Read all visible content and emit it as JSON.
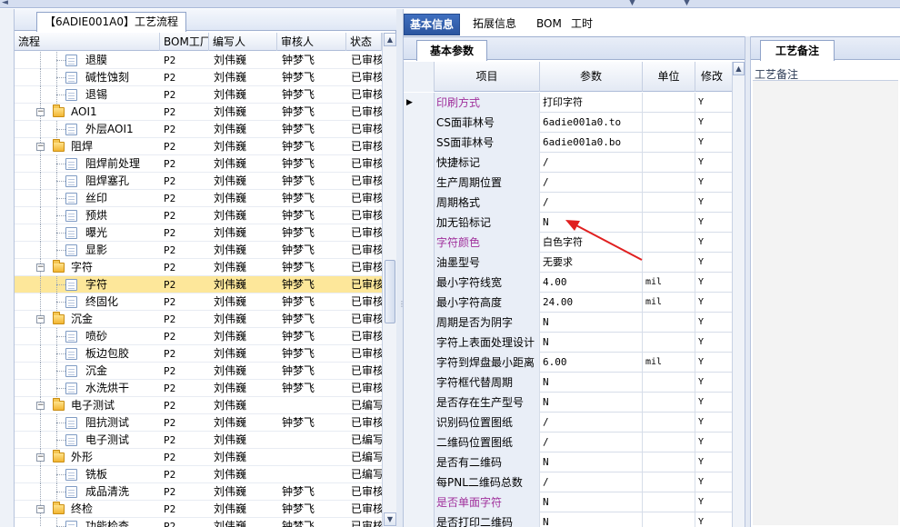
{
  "left_panel": {
    "tab_title": "【6ADIE001A0】工艺流程",
    "columns": [
      "流程",
      "BOM工厂",
      "编写人",
      "审核人",
      "状态"
    ],
    "rows": [
      {
        "name": "退膜",
        "bom": "P2",
        "writer": "刘伟巍",
        "reviewer": "钟梦飞",
        "status": "已审核",
        "level": 2
      },
      {
        "name": "碱性蚀刻",
        "bom": "P2",
        "writer": "刘伟巍",
        "reviewer": "钟梦飞",
        "status": "已审核",
        "level": 2
      },
      {
        "name": "退锡",
        "bom": "P2",
        "writer": "刘伟巍",
        "reviewer": "钟梦飞",
        "status": "已审核",
        "level": 2
      },
      {
        "name": "AOI1",
        "bom": "P2",
        "writer": "刘伟巍",
        "reviewer": "钟梦飞",
        "status": "已审核",
        "level": 1
      },
      {
        "name": "外层AOI1",
        "bom": "P2",
        "writer": "刘伟巍",
        "reviewer": "钟梦飞",
        "status": "已审核",
        "level": 2
      },
      {
        "name": "阻焊",
        "bom": "P2",
        "writer": "刘伟巍",
        "reviewer": "钟梦飞",
        "status": "已审核",
        "level": 1
      },
      {
        "name": "阻焊前处理",
        "bom": "P2",
        "writer": "刘伟巍",
        "reviewer": "钟梦飞",
        "status": "已审核",
        "level": 2
      },
      {
        "name": "阻焊塞孔",
        "bom": "P2",
        "writer": "刘伟巍",
        "reviewer": "钟梦飞",
        "status": "已审核",
        "level": 2
      },
      {
        "name": "丝印",
        "bom": "P2",
        "writer": "刘伟巍",
        "reviewer": "钟梦飞",
        "status": "已审核",
        "level": 2
      },
      {
        "name": "预烘",
        "bom": "P2",
        "writer": "刘伟巍",
        "reviewer": "钟梦飞",
        "status": "已审核",
        "level": 2
      },
      {
        "name": "曝光",
        "bom": "P2",
        "writer": "刘伟巍",
        "reviewer": "钟梦飞",
        "status": "已审核",
        "level": 2
      },
      {
        "name": "显影",
        "bom": "P2",
        "writer": "刘伟巍",
        "reviewer": "钟梦飞",
        "status": "已审核",
        "level": 2
      },
      {
        "name": "字符",
        "bom": "P2",
        "writer": "刘伟巍",
        "reviewer": "钟梦飞",
        "status": "已审核",
        "level": 1
      },
      {
        "name": "字符",
        "bom": "P2",
        "writer": "刘伟巍",
        "reviewer": "钟梦飞",
        "status": "已审核",
        "level": 2,
        "selected": true
      },
      {
        "name": "终固化",
        "bom": "P2",
        "writer": "刘伟巍",
        "reviewer": "钟梦飞",
        "status": "已审核",
        "level": 2
      },
      {
        "name": "沉金",
        "bom": "P2",
        "writer": "刘伟巍",
        "reviewer": "钟梦飞",
        "status": "已审核",
        "level": 1
      },
      {
        "name": "喷砂",
        "bom": "P2",
        "writer": "刘伟巍",
        "reviewer": "钟梦飞",
        "status": "已审核",
        "level": 2
      },
      {
        "name": "板边包胶",
        "bom": "P2",
        "writer": "刘伟巍",
        "reviewer": "钟梦飞",
        "status": "已审核",
        "level": 2
      },
      {
        "name": "沉金",
        "bom": "P2",
        "writer": "刘伟巍",
        "reviewer": "钟梦飞",
        "status": "已审核",
        "level": 2
      },
      {
        "name": "水洗烘干",
        "bom": "P2",
        "writer": "刘伟巍",
        "reviewer": "钟梦飞",
        "status": "已审核",
        "level": 2
      },
      {
        "name": "电子测试",
        "bom": "P2",
        "writer": "刘伟巍",
        "reviewer": "",
        "status": "已编写",
        "level": 1
      },
      {
        "name": "阻抗测试",
        "bom": "P2",
        "writer": "刘伟巍",
        "reviewer": "钟梦飞",
        "status": "已审核",
        "level": 2
      },
      {
        "name": "电子测试",
        "bom": "P2",
        "writer": "刘伟巍",
        "reviewer": "",
        "status": "已编写",
        "level": 2
      },
      {
        "name": "外形",
        "bom": "P2",
        "writer": "刘伟巍",
        "reviewer": "",
        "status": "已编写",
        "level": 1
      },
      {
        "name": "铣板",
        "bom": "P2",
        "writer": "刘伟巍",
        "reviewer": "",
        "status": "已编写",
        "level": 2
      },
      {
        "name": "成品清洗",
        "bom": "P2",
        "writer": "刘伟巍",
        "reviewer": "钟梦飞",
        "status": "已审核",
        "level": 2
      },
      {
        "name": "终检",
        "bom": "P2",
        "writer": "刘伟巍",
        "reviewer": "钟梦飞",
        "status": "已审核",
        "level": 1
      },
      {
        "name": "功能检查",
        "bom": "P2",
        "writer": "刘伟巍",
        "reviewer": "钟梦飞",
        "status": "已审核",
        "level": 2
      }
    ]
  },
  "middle_panel": {
    "tabs": [
      "基本信息",
      "拓展信息",
      "BOM",
      "工时"
    ],
    "active_tab": "基本信息",
    "sub_tab": "基本参数",
    "columns": [
      "项目",
      "参数",
      "单位",
      "修改"
    ],
    "rows": [
      {
        "item": "印刷方式",
        "value": "打印字符",
        "unit": "",
        "mod": "Y",
        "highlight": true,
        "current": true
      },
      {
        "item": "CS面菲林号",
        "value": "6adie001a0.to",
        "unit": "",
        "mod": "Y"
      },
      {
        "item": "SS面菲林号",
        "value": "6adie001a0.bo",
        "unit": "",
        "mod": "Y"
      },
      {
        "item": "快捷标记",
        "value": "/",
        "unit": "",
        "mod": "Y"
      },
      {
        "item": "生产周期位置",
        "value": "/",
        "unit": "",
        "mod": "Y"
      },
      {
        "item": "周期格式",
        "value": "/",
        "unit": "",
        "mod": "Y"
      },
      {
        "item": "加无铅标记",
        "value": "N",
        "unit": "",
        "mod": "Y"
      },
      {
        "item": "字符颜色",
        "value": "白色字符",
        "unit": "",
        "mod": "Y",
        "highlight": true
      },
      {
        "item": "油墨型号",
        "value": "无要求",
        "unit": "",
        "mod": "Y"
      },
      {
        "item": "最小字符线宽",
        "value": "4.00",
        "unit": "mil",
        "mod": "Y"
      },
      {
        "item": "最小字符高度",
        "value": "24.00",
        "unit": "mil",
        "mod": "Y"
      },
      {
        "item": "周期是否为阴字",
        "value": "N",
        "unit": "",
        "mod": "Y"
      },
      {
        "item": "字符上表面处理设计",
        "value": "N",
        "unit": "",
        "mod": "Y"
      },
      {
        "item": "字符到焊盘最小距离",
        "value": "6.00",
        "unit": "mil",
        "mod": "Y"
      },
      {
        "item": "字符框代替周期",
        "value": "N",
        "unit": "",
        "mod": "Y"
      },
      {
        "item": "是否存在生产型号",
        "value": "N",
        "unit": "",
        "mod": "Y"
      },
      {
        "item": "识别码位置图纸",
        "value": "/",
        "unit": "",
        "mod": "Y"
      },
      {
        "item": "二维码位置图纸",
        "value": "/",
        "unit": "",
        "mod": "Y"
      },
      {
        "item": "是否有二维码",
        "value": "N",
        "unit": "",
        "mod": "Y"
      },
      {
        "item": "每PNL二维码总数",
        "value": "/",
        "unit": "",
        "mod": "Y"
      },
      {
        "item": "是否单面字符",
        "value": "N",
        "unit": "",
        "mod": "Y",
        "highlight": true
      },
      {
        "item": "是否打印二维码",
        "value": "N",
        "unit": "",
        "mod": "Y"
      }
    ]
  },
  "right_panel": {
    "tab": "工艺备注",
    "label": "工艺备注"
  },
  "colors": {
    "selected_row": "#fde79a",
    "active_tab": "#2b559f",
    "highlight_item": "#a0309c",
    "annotation_arrow": "#e02020"
  }
}
